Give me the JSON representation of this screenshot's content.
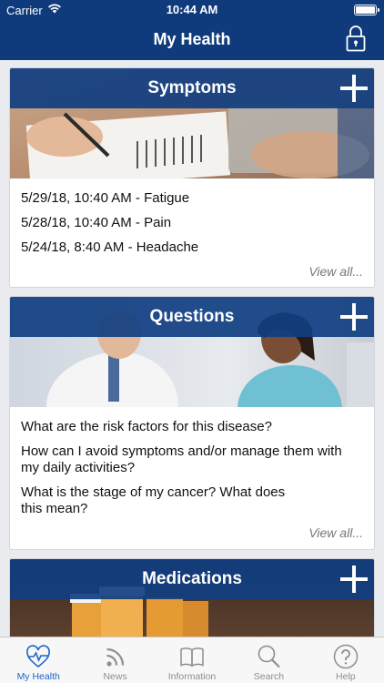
{
  "status": {
    "carrier": "Carrier",
    "time": "10:44 AM"
  },
  "header": {
    "title": "My Health"
  },
  "symptoms": {
    "title": "Symptoms",
    "items": [
      "5/29/18, 10:40 AM - Fatigue",
      "5/28/18, 10:40 AM - Pain",
      "5/24/18, 8:40 AM - Headache"
    ],
    "view_all": "View all..."
  },
  "questions": {
    "title": "Questions",
    "items": [
      "What are the risk factors for this disease?",
      "How can I avoid symptoms and/or manage them with my daily activities?",
      "What is the stage of my cancer? What does this mean?"
    ],
    "view_all": "View all..."
  },
  "medications": {
    "title": "Medications"
  },
  "tabs": [
    {
      "label": "My Health",
      "icon": "heart-pulse-icon",
      "active": true
    },
    {
      "label": "News",
      "icon": "rss-icon",
      "active": false
    },
    {
      "label": "Information",
      "icon": "book-icon",
      "active": false
    },
    {
      "label": "Search",
      "icon": "search-icon",
      "active": false
    },
    {
      "label": "Help",
      "icon": "help-icon",
      "active": false
    }
  ],
  "colors": {
    "brand": "#0f3b7c",
    "tab_active": "#1a66c6",
    "tab_inactive": "#8e8e93"
  }
}
